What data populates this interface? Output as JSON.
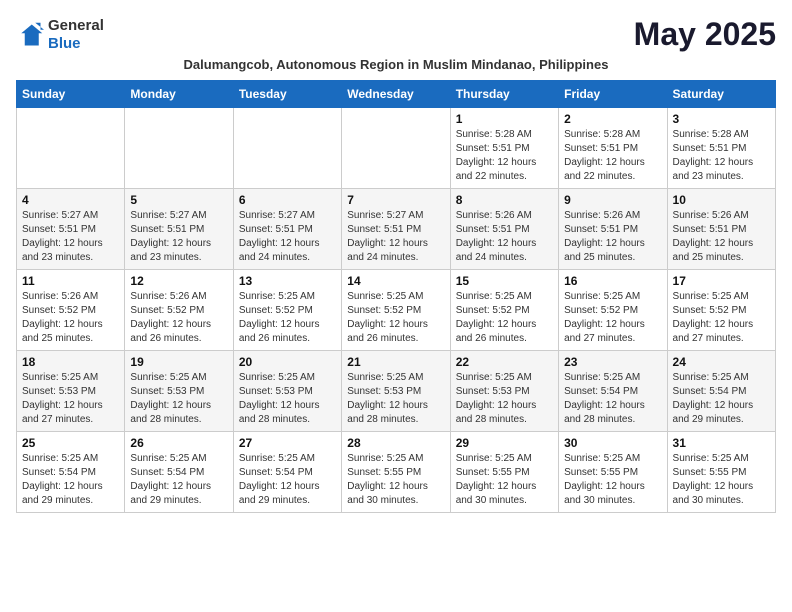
{
  "header": {
    "logo_general": "General",
    "logo_blue": "Blue",
    "month_title": "May 2025",
    "subtitle": "Dalumangcob, Autonomous Region in Muslim Mindanao, Philippines"
  },
  "weekdays": [
    "Sunday",
    "Monday",
    "Tuesday",
    "Wednesday",
    "Thursday",
    "Friday",
    "Saturday"
  ],
  "weeks": [
    [
      {
        "day": "",
        "info": ""
      },
      {
        "day": "",
        "info": ""
      },
      {
        "day": "",
        "info": ""
      },
      {
        "day": "",
        "info": ""
      },
      {
        "day": "1",
        "info": "Sunrise: 5:28 AM\nSunset: 5:51 PM\nDaylight: 12 hours\nand 22 minutes."
      },
      {
        "day": "2",
        "info": "Sunrise: 5:28 AM\nSunset: 5:51 PM\nDaylight: 12 hours\nand 22 minutes."
      },
      {
        "day": "3",
        "info": "Sunrise: 5:28 AM\nSunset: 5:51 PM\nDaylight: 12 hours\nand 23 minutes."
      }
    ],
    [
      {
        "day": "4",
        "info": "Sunrise: 5:27 AM\nSunset: 5:51 PM\nDaylight: 12 hours\nand 23 minutes."
      },
      {
        "day": "5",
        "info": "Sunrise: 5:27 AM\nSunset: 5:51 PM\nDaylight: 12 hours\nand 23 minutes."
      },
      {
        "day": "6",
        "info": "Sunrise: 5:27 AM\nSunset: 5:51 PM\nDaylight: 12 hours\nand 24 minutes."
      },
      {
        "day": "7",
        "info": "Sunrise: 5:27 AM\nSunset: 5:51 PM\nDaylight: 12 hours\nand 24 minutes."
      },
      {
        "day": "8",
        "info": "Sunrise: 5:26 AM\nSunset: 5:51 PM\nDaylight: 12 hours\nand 24 minutes."
      },
      {
        "day": "9",
        "info": "Sunrise: 5:26 AM\nSunset: 5:51 PM\nDaylight: 12 hours\nand 25 minutes."
      },
      {
        "day": "10",
        "info": "Sunrise: 5:26 AM\nSunset: 5:51 PM\nDaylight: 12 hours\nand 25 minutes."
      }
    ],
    [
      {
        "day": "11",
        "info": "Sunrise: 5:26 AM\nSunset: 5:52 PM\nDaylight: 12 hours\nand 25 minutes."
      },
      {
        "day": "12",
        "info": "Sunrise: 5:26 AM\nSunset: 5:52 PM\nDaylight: 12 hours\nand 26 minutes."
      },
      {
        "day": "13",
        "info": "Sunrise: 5:25 AM\nSunset: 5:52 PM\nDaylight: 12 hours\nand 26 minutes."
      },
      {
        "day": "14",
        "info": "Sunrise: 5:25 AM\nSunset: 5:52 PM\nDaylight: 12 hours\nand 26 minutes."
      },
      {
        "day": "15",
        "info": "Sunrise: 5:25 AM\nSunset: 5:52 PM\nDaylight: 12 hours\nand 26 minutes."
      },
      {
        "day": "16",
        "info": "Sunrise: 5:25 AM\nSunset: 5:52 PM\nDaylight: 12 hours\nand 27 minutes."
      },
      {
        "day": "17",
        "info": "Sunrise: 5:25 AM\nSunset: 5:52 PM\nDaylight: 12 hours\nand 27 minutes."
      }
    ],
    [
      {
        "day": "18",
        "info": "Sunrise: 5:25 AM\nSunset: 5:53 PM\nDaylight: 12 hours\nand 27 minutes."
      },
      {
        "day": "19",
        "info": "Sunrise: 5:25 AM\nSunset: 5:53 PM\nDaylight: 12 hours\nand 28 minutes."
      },
      {
        "day": "20",
        "info": "Sunrise: 5:25 AM\nSunset: 5:53 PM\nDaylight: 12 hours\nand 28 minutes."
      },
      {
        "day": "21",
        "info": "Sunrise: 5:25 AM\nSunset: 5:53 PM\nDaylight: 12 hours\nand 28 minutes."
      },
      {
        "day": "22",
        "info": "Sunrise: 5:25 AM\nSunset: 5:53 PM\nDaylight: 12 hours\nand 28 minutes."
      },
      {
        "day": "23",
        "info": "Sunrise: 5:25 AM\nSunset: 5:54 PM\nDaylight: 12 hours\nand 28 minutes."
      },
      {
        "day": "24",
        "info": "Sunrise: 5:25 AM\nSunset: 5:54 PM\nDaylight: 12 hours\nand 29 minutes."
      }
    ],
    [
      {
        "day": "25",
        "info": "Sunrise: 5:25 AM\nSunset: 5:54 PM\nDaylight: 12 hours\nand 29 minutes."
      },
      {
        "day": "26",
        "info": "Sunrise: 5:25 AM\nSunset: 5:54 PM\nDaylight: 12 hours\nand 29 minutes."
      },
      {
        "day": "27",
        "info": "Sunrise: 5:25 AM\nSunset: 5:54 PM\nDaylight: 12 hours\nand 29 minutes."
      },
      {
        "day": "28",
        "info": "Sunrise: 5:25 AM\nSunset: 5:55 PM\nDaylight: 12 hours\nand 30 minutes."
      },
      {
        "day": "29",
        "info": "Sunrise: 5:25 AM\nSunset: 5:55 PM\nDaylight: 12 hours\nand 30 minutes."
      },
      {
        "day": "30",
        "info": "Sunrise: 5:25 AM\nSunset: 5:55 PM\nDaylight: 12 hours\nand 30 minutes."
      },
      {
        "day": "31",
        "info": "Sunrise: 5:25 AM\nSunset: 5:55 PM\nDaylight: 12 hours\nand 30 minutes."
      }
    ]
  ]
}
